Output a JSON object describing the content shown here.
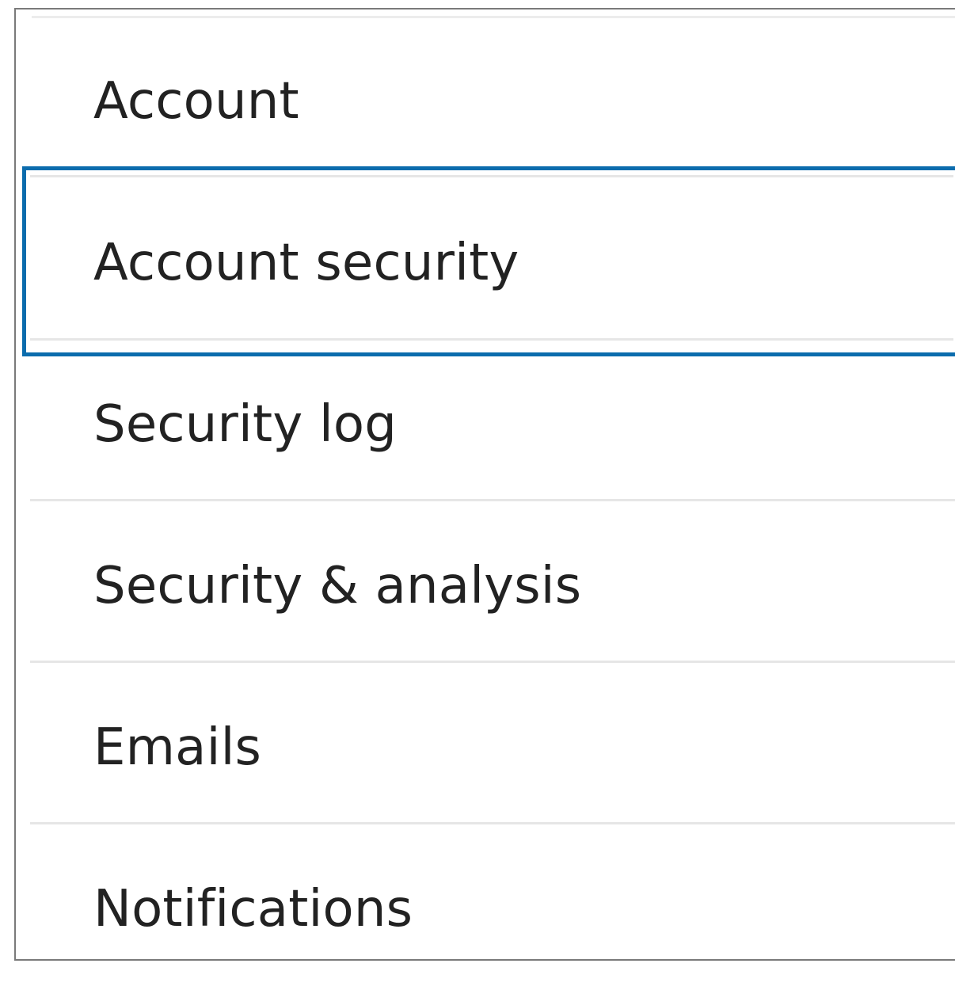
{
  "menu": {
    "items": [
      {
        "label": "Account",
        "selected": false
      },
      {
        "label": "Account security",
        "selected": true
      },
      {
        "label": "Security log",
        "selected": false
      },
      {
        "label": "Security & analysis",
        "selected": false
      },
      {
        "label": "Emails",
        "selected": false
      },
      {
        "label": "Notifications",
        "selected": false
      }
    ]
  },
  "colors": {
    "selection_outline": "#0b6cad",
    "divider": "#e6e6e6",
    "text": "#222222",
    "panel_border": "#7a7a7a"
  }
}
